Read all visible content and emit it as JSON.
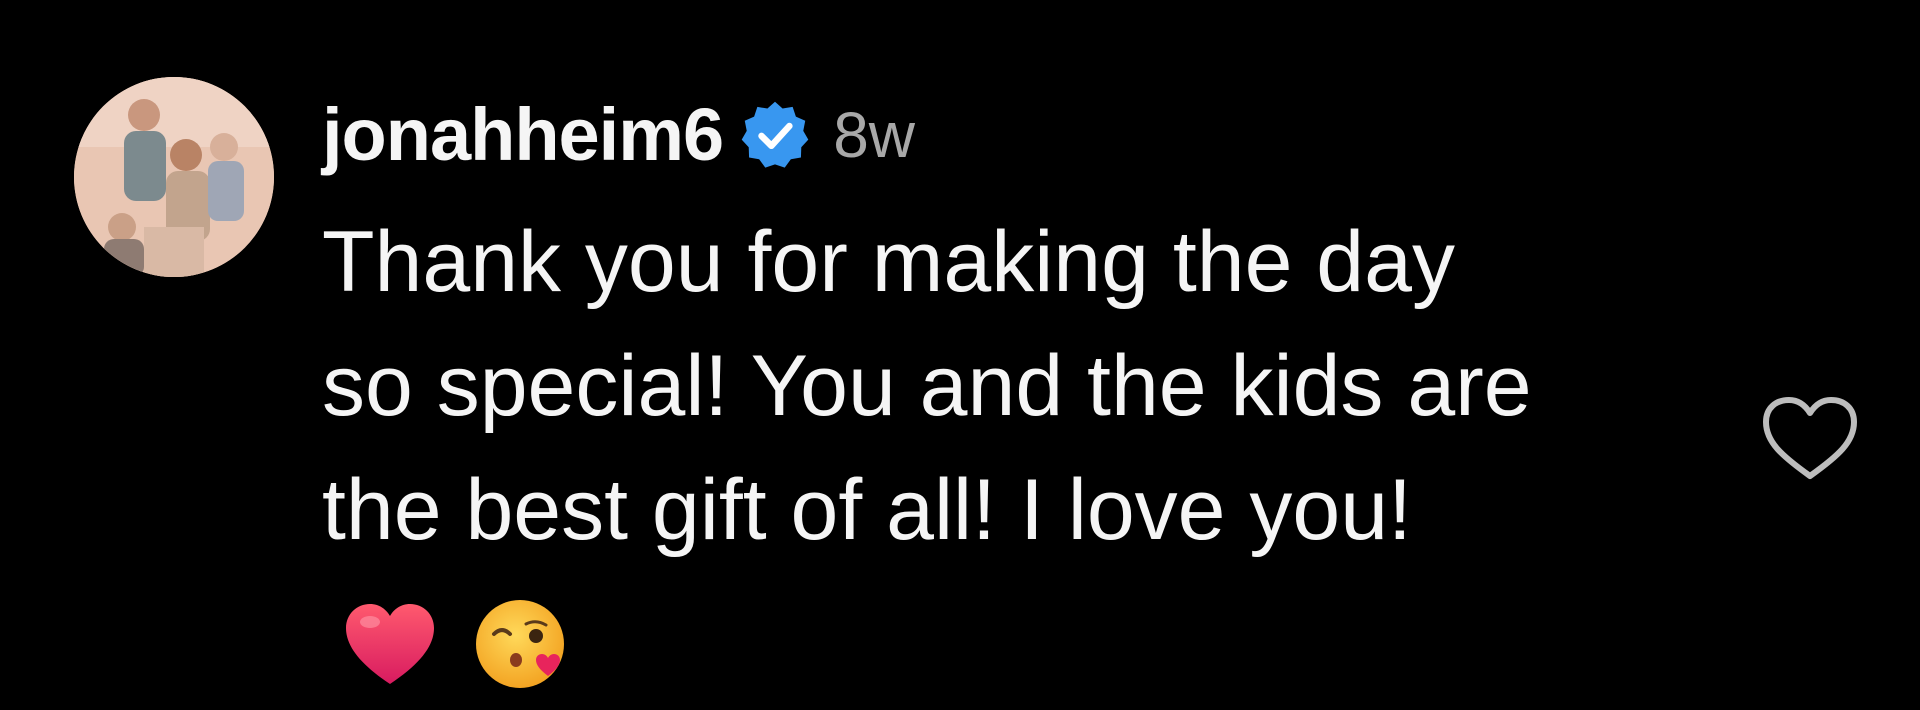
{
  "comment": {
    "username": "jonahheim6",
    "verified_icon": "verified-badge-icon",
    "time": "8w",
    "text_lines": [
      "Thank you for making the day",
      "so special! You and the kids are",
      "the best gift of all! I love you!"
    ],
    "emojis": [
      "red-heart-emoji",
      "face-blowing-kiss-emoji"
    ],
    "like_icon": "heart-outline-icon"
  },
  "colors": {
    "background": "#000000",
    "text": "#f5f5f5",
    "muted": "#a8a8a8",
    "verified": "#3897f0"
  }
}
